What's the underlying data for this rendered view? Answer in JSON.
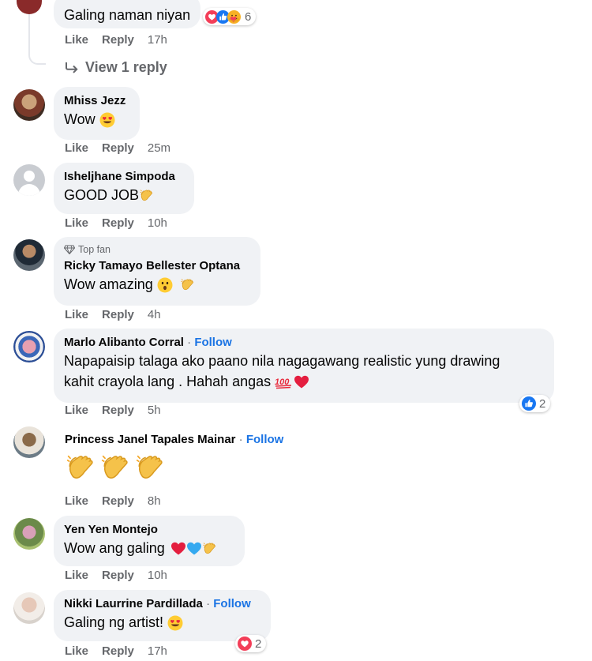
{
  "colors": {
    "bubble": "#f0f2f5",
    "secondary_text": "#65676b",
    "follow_blue": "#1b74e4",
    "like_blue": "#1877f2",
    "love_red": "#f33e58"
  },
  "top_comment": {
    "text": "Galing naman niyan",
    "reactions": [
      "love-icon",
      "like-icon",
      "care-icon"
    ],
    "reaction_count": "6",
    "like": "Like",
    "reply": "Reply",
    "time": "17h",
    "view_replies": "View 1 reply"
  },
  "comments": [
    {
      "name": "Mhiss Jezz",
      "text": "Wow",
      "emoji": [
        "heart-eyes-emoji"
      ],
      "like": "Like",
      "reply": "Reply",
      "time": "25m"
    },
    {
      "name": "Isheljhane Simpoda",
      "text": "GOOD JOB",
      "emoji": [
        "clap-emoji"
      ],
      "like": "Like",
      "reply": "Reply",
      "time": "10h"
    },
    {
      "badge": "Top fan",
      "name": "Ricky Tamayo Bellester Optana",
      "text": "Wow amazing",
      "emoji": [
        "surprised-emoji",
        "clap-emoji"
      ],
      "like": "Like",
      "reply": "Reply",
      "time": "4h"
    },
    {
      "name": "Marlo Alibanto Corral",
      "follow": "Follow",
      "text_lines": [
        "Napapaisip talaga ako paano nila nagagawang realistic yung drawing",
        "kahit crayola lang . Hahah angas"
      ],
      "emoji": [
        "hundred-emoji",
        "red-heart-emoji"
      ],
      "reaction_count": "2",
      "like": "Like",
      "reply": "Reply",
      "time": "5h"
    },
    {
      "name": "Princess Janel Tapales Mainar",
      "follow": "Follow",
      "emoji": [
        "clap-emoji",
        "clap-emoji",
        "clap-emoji"
      ],
      "like": "Like",
      "reply": "Reply",
      "time": "8h"
    },
    {
      "name": "Yen Yen Montejo",
      "text": "Wow ang galing",
      "emoji": [
        "red-heart-emoji",
        "blue-heart-emoji",
        "clap-emoji"
      ],
      "like": "Like",
      "reply": "Reply",
      "time": "10h"
    },
    {
      "name": "Nikki Laurrine Pardillada",
      "follow": "Follow",
      "text": "Galing ng artist!",
      "emoji": [
        "heart-eyes-emoji"
      ],
      "reaction_count": "2",
      "like": "Like",
      "reply": "Reply",
      "time": "17h"
    }
  ],
  "separator": "·"
}
